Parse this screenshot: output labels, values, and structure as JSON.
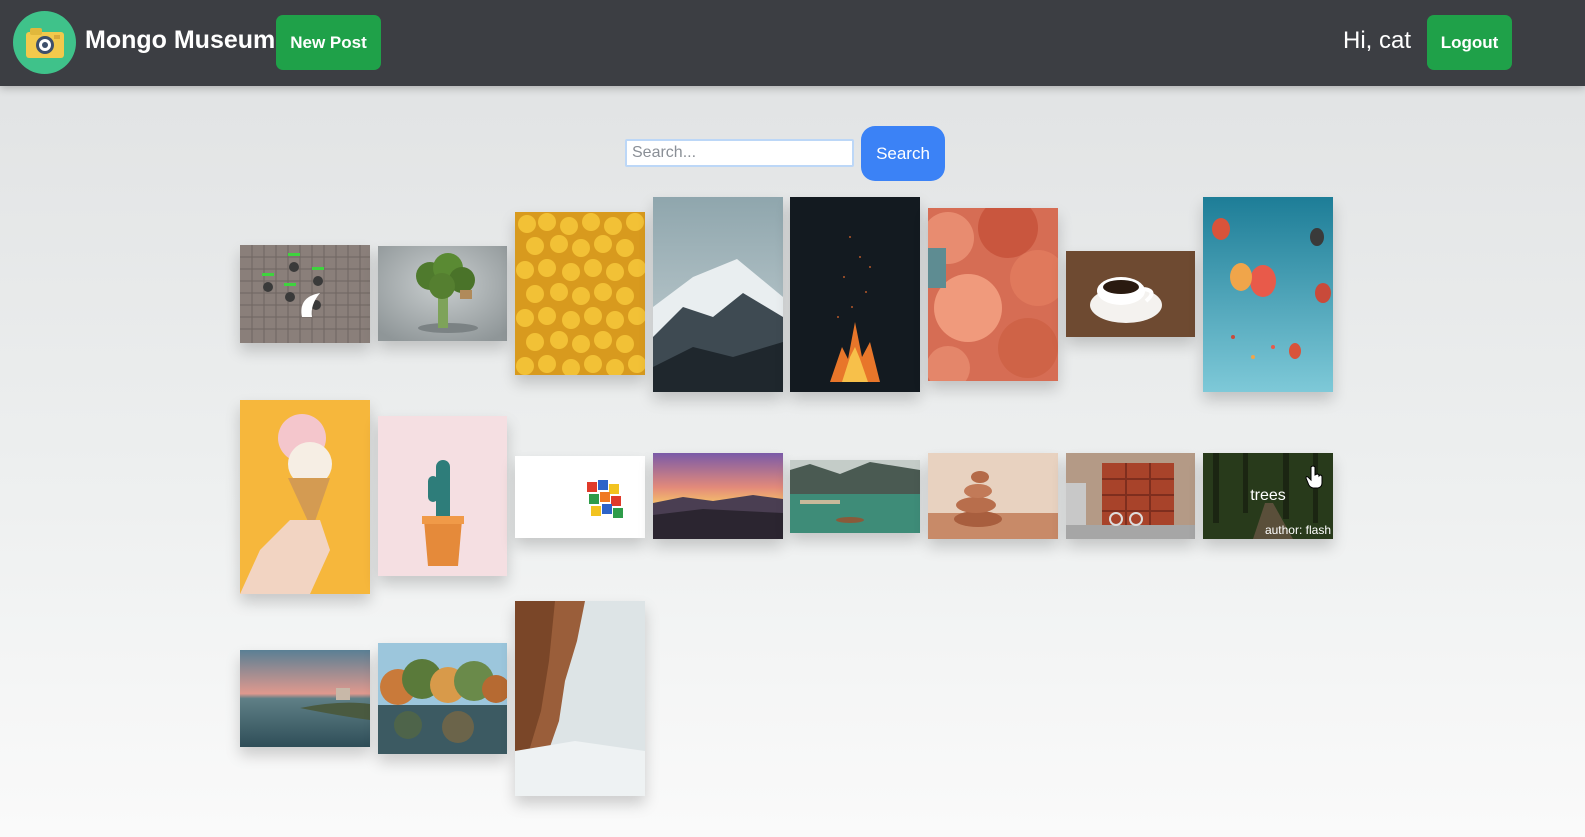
{
  "navbar": {
    "brand": "Mongo Museum",
    "logo_icon": "camera-icon",
    "new_post_label": "New Post",
    "greeting": "Hi, cat",
    "logout_label": "Logout",
    "colors": {
      "bar": "#3c3e43",
      "button": "#1fa149",
      "logo": "#3fc28a"
    }
  },
  "search": {
    "placeholder": "Search...",
    "value": "",
    "button_label": "Search",
    "button_color": "#3b82f6"
  },
  "gallery": {
    "hovered_post": {
      "title": "trees",
      "author": "author: flash"
    }
  }
}
